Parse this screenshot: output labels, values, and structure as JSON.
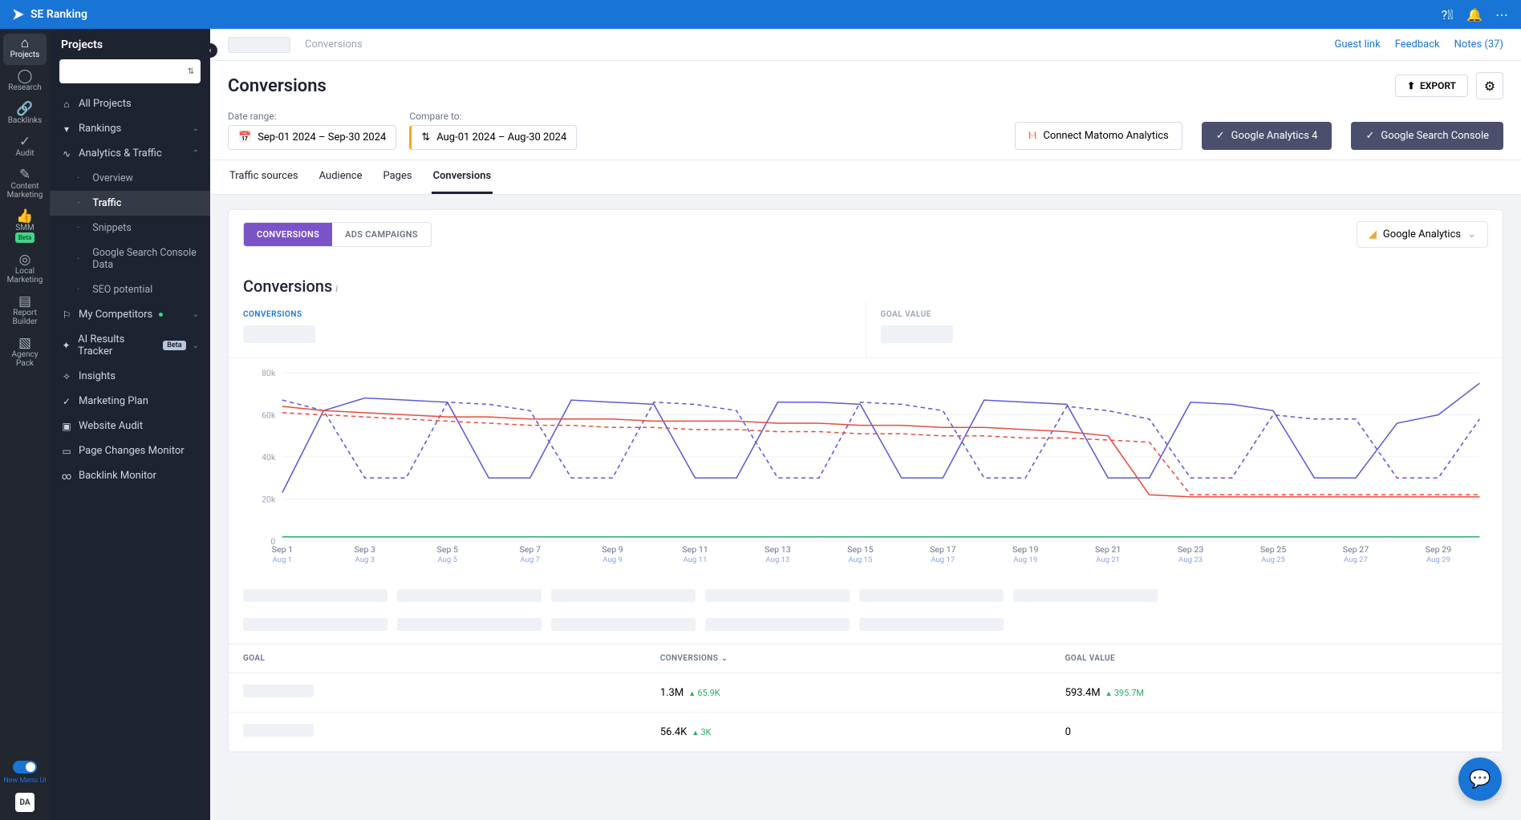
{
  "brand": "SE Ranking",
  "topbar_icons": [
    "help-icon",
    "bell-icon",
    "more-icon"
  ],
  "rail": [
    {
      "icon": "⌂",
      "label": "Projects",
      "active": true
    },
    {
      "icon": "◯",
      "label": "Research"
    },
    {
      "icon": "🔗",
      "label": "Backlinks"
    },
    {
      "icon": "✓",
      "label": "Audit"
    },
    {
      "icon": "✎",
      "label": "Content Marketing"
    },
    {
      "icon": "👍",
      "label": "SMM",
      "badge": "Beta"
    },
    {
      "icon": "◎",
      "label": "Local Marketing"
    },
    {
      "icon": "▤",
      "label": "Report Builder"
    },
    {
      "icon": "▧",
      "label": "Agency Pack"
    }
  ],
  "rail_toggle_label": "New Menu UI",
  "rail_da": "DA",
  "sidebar": {
    "title": "Projects",
    "items": [
      {
        "label": "All Projects",
        "icon": "⌂"
      },
      {
        "label": "Rankings",
        "icon": "▾",
        "chev": true
      },
      {
        "label": "Analytics & Traffic",
        "icon": "∿",
        "chev": true,
        "open": true,
        "children": [
          {
            "label": "Overview"
          },
          {
            "label": "Traffic",
            "active": true
          },
          {
            "label": "Snippets"
          },
          {
            "label": "Google Search Console Data"
          },
          {
            "label": "SEO potential"
          }
        ]
      },
      {
        "label": "My Competitors",
        "icon": "⚐",
        "dot": true,
        "chev": true
      },
      {
        "label": "AI Results Tracker",
        "icon": "✦",
        "beta": "Beta",
        "chev": true
      },
      {
        "label": "Insights",
        "icon": "✧"
      },
      {
        "label": "Marketing Plan",
        "icon": "✓"
      },
      {
        "label": "Website Audit",
        "icon": "▣"
      },
      {
        "label": "Page Changes Monitor",
        "icon": "▭"
      },
      {
        "label": "Backlink Monitor",
        "icon": "∞"
      }
    ]
  },
  "crumbs": {
    "current": "Conversions",
    "links": [
      "Guest link",
      "Feedback",
      "Notes (37)"
    ]
  },
  "header": {
    "title": "Conversions",
    "export": "EXPORT"
  },
  "controls": {
    "date_label": "Date range:",
    "date_value": "Sep-01 2024 – Sep-30 2024",
    "compare_label": "Compare to:",
    "compare_value": "Aug-01 2024 – Aug-30 2024",
    "connect": "Connect Matomo Analytics",
    "ga4": "Google Analytics 4",
    "gsc": "Google Search Console"
  },
  "tabs": [
    "Traffic sources",
    "Audience",
    "Pages",
    "Conversions"
  ],
  "tabs_active": 3,
  "seg": [
    "CONVERSIONS",
    "ADS CAMPAIGNS"
  ],
  "seg_active": 0,
  "ga_drop": "Google Analytics",
  "section_title": "Conversions",
  "kpis": [
    {
      "label": "CONVERSIONS"
    },
    {
      "label": "GOAL VALUE",
      "grey": true
    }
  ],
  "table": {
    "cols": [
      "GOAL",
      "CONVERSIONS",
      "GOAL VALUE"
    ],
    "rows": [
      {
        "conv": "1.3M",
        "conv_delta": "65.9K",
        "gv": "593.4M",
        "gv_delta": "395.7M"
      },
      {
        "conv": "56.4K",
        "conv_delta": "3K",
        "gv": "0",
        "gv_delta": null
      }
    ]
  },
  "chart_data": {
    "type": "line",
    "ylabel": "",
    "ylim": [
      0,
      80000
    ],
    "yticks": [
      0,
      20000,
      40000,
      60000,
      80000
    ],
    "ytick_labels": [
      "0",
      "20k",
      "40k",
      "60k",
      "80k"
    ],
    "x_primary": [
      "Sep 1",
      "Sep 3",
      "Sep 5",
      "Sep 7",
      "Sep 9",
      "Sep 11",
      "Sep 13",
      "Sep 15",
      "Sep 17",
      "Sep 19",
      "Sep 21",
      "Sep 23",
      "Sep 25",
      "Sep 27",
      "Sep 29"
    ],
    "x_compare": [
      "Aug 1",
      "Aug 3",
      "Aug 5",
      "Aug 7",
      "Aug 9",
      "Aug 11",
      "Aug 13",
      "Aug 15",
      "Aug 17",
      "Aug 19",
      "Aug 21",
      "Aug 23",
      "Aug 25",
      "Aug 27",
      "Aug 29"
    ],
    "series": [
      {
        "name": "current-blue",
        "color": "#5b5bd6",
        "dash": false,
        "values": [
          23000,
          62000,
          68000,
          67000,
          66000,
          30000,
          30000,
          67000,
          66000,
          65000,
          30000,
          30000,
          66000,
          66000,
          65000,
          30000,
          30000,
          67000,
          66000,
          65000,
          30000,
          30000,
          66000,
          65000,
          62000,
          30000,
          30000,
          56000,
          60000,
          75000
        ]
      },
      {
        "name": "compare-blue",
        "color": "#5b5bd6",
        "dash": true,
        "values": [
          67000,
          62000,
          30000,
          30000,
          66000,
          65000,
          62000,
          30000,
          30000,
          66000,
          65000,
          62000,
          30000,
          30000,
          66000,
          65000,
          62000,
          30000,
          30000,
          64000,
          62000,
          58000,
          30000,
          30000,
          60000,
          58000,
          58000,
          30000,
          30000,
          58000
        ]
      },
      {
        "name": "current-red",
        "color": "#e74c3c",
        "dash": false,
        "values": [
          64000,
          62000,
          61000,
          60000,
          59000,
          59000,
          58000,
          58000,
          58000,
          57000,
          57000,
          57000,
          56000,
          56000,
          55000,
          55000,
          54000,
          54000,
          53000,
          52000,
          50000,
          22000,
          21000,
          21000,
          21000,
          21000,
          21000,
          21000,
          21000,
          21000
        ]
      },
      {
        "name": "compare-red",
        "color": "#e74c3c",
        "dash": true,
        "values": [
          61000,
          60000,
          59000,
          58000,
          57000,
          56000,
          55000,
          55000,
          54000,
          54000,
          53000,
          53000,
          52000,
          52000,
          51000,
          51000,
          50000,
          50000,
          49000,
          49000,
          48000,
          47000,
          22000,
          22000,
          22000,
          22000,
          22000,
          22000,
          22000,
          22000
        ]
      },
      {
        "name": "current-green",
        "color": "#27ae60",
        "dash": false,
        "values": [
          2000,
          2000,
          2000,
          2000,
          2000,
          2000,
          2000,
          2000,
          2000,
          2000,
          2000,
          2000,
          2000,
          2000,
          2000,
          2000,
          2000,
          2000,
          2000,
          2000,
          2000,
          2000,
          2000,
          2000,
          2000,
          2000,
          2000,
          2000,
          2000,
          2000
        ]
      },
      {
        "name": "compare-green",
        "color": "#27ae60",
        "dash": true,
        "values": [
          2000,
          2000,
          2000,
          2000,
          2000,
          2000,
          2000,
          2000,
          2000,
          2000,
          2000,
          2000,
          2000,
          2000,
          2000,
          2000,
          2000,
          2000,
          2000,
          2000,
          2000,
          2000,
          2000,
          2000,
          2000,
          2000,
          2000,
          2000,
          2000,
          2000
        ]
      }
    ]
  }
}
